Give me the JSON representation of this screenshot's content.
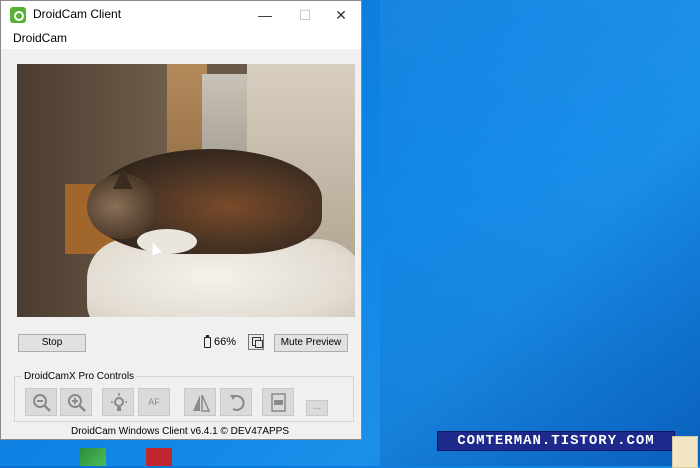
{
  "window": {
    "title": "DroidCam Client",
    "controls": {
      "minimize": "—",
      "maximize": "☐",
      "close": "✕"
    }
  },
  "menu": {
    "items": [
      "DroidCam"
    ]
  },
  "status": {
    "stop_label": "Stop",
    "battery": "66%",
    "mute_label": "Mute Preview"
  },
  "pro_controls": {
    "label": "DroidCamX Pro Controls",
    "tools": [
      {
        "name": "zoom-out-icon"
      },
      {
        "name": "zoom-in-icon"
      },
      {
        "name": "flash-icon"
      },
      {
        "name": "autofocus-button",
        "label": "AF"
      },
      {
        "name": "mirror-icon"
      },
      {
        "name": "rotate-icon"
      },
      {
        "name": "jpeg-icon"
      },
      {
        "name": "more-button",
        "label": "..."
      }
    ]
  },
  "footer": "DroidCam Windows Client v6.4.1 © DEV47APPS",
  "watermark": "COMTERMAN.TISTORY.COM"
}
